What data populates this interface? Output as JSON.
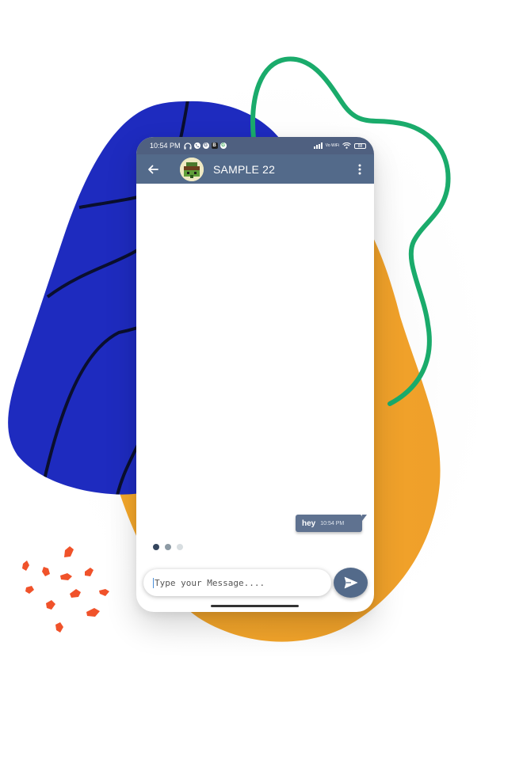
{
  "status_bar": {
    "time": "10:54 PM",
    "notification_icons": [
      "headset-icon",
      "phone-icon",
      "g-app-icon",
      "b-app-icon",
      "google-icon"
    ],
    "notification_letters": [
      "",
      "",
      "G",
      "B",
      "G"
    ],
    "network_label": "Vo WiFi",
    "battery_level": "88"
  },
  "header": {
    "title": "SAMPLE 22",
    "back_icon": "arrow-left-icon",
    "menu_icon": "more-vertical-icon"
  },
  "messages": [
    {
      "text": "hey",
      "time": "10:54 PM",
      "direction": "outgoing"
    }
  ],
  "typing_indicator": {
    "colors": [
      "#35465e",
      "#8d9aa4",
      "#d8dee1"
    ]
  },
  "composer": {
    "placeholder": "Type your Message....",
    "send_icon": "send-icon"
  },
  "colors": {
    "primary": "#536a8a",
    "status_bar": "#4f6080",
    "bubble": "#5f7290",
    "blob_blue": "#1e2bbf",
    "blob_orange": "#f3a62a",
    "squiggle_green": "#1aab6b",
    "confetti": "#f0522a"
  }
}
